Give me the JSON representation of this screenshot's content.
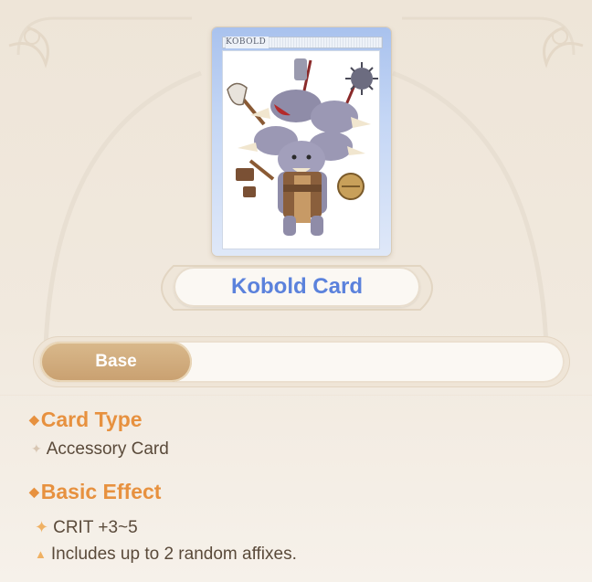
{
  "card": {
    "name_strip": "KOBOLD",
    "title": "Kobold Card",
    "art_description_icon": "kobold-monster-illustration-icon"
  },
  "tabs": [
    {
      "label": "Base",
      "selected": true
    }
  ],
  "sections": {
    "card_type": {
      "heading": "Card Type",
      "value": "Accessory Card"
    },
    "basic_effect": {
      "heading": "Basic Effect",
      "items": [
        {
          "icon": "star-icon",
          "text": "CRIT +3~5"
        },
        {
          "icon": "triangle-icon",
          "text": "Includes up to 2 random affixes."
        }
      ]
    }
  },
  "colors": {
    "accent_orange": "#e7913f",
    "title_blue": "#5b82dc",
    "tab_selected": "#c9a070",
    "body_text": "#5a4a3a"
  }
}
